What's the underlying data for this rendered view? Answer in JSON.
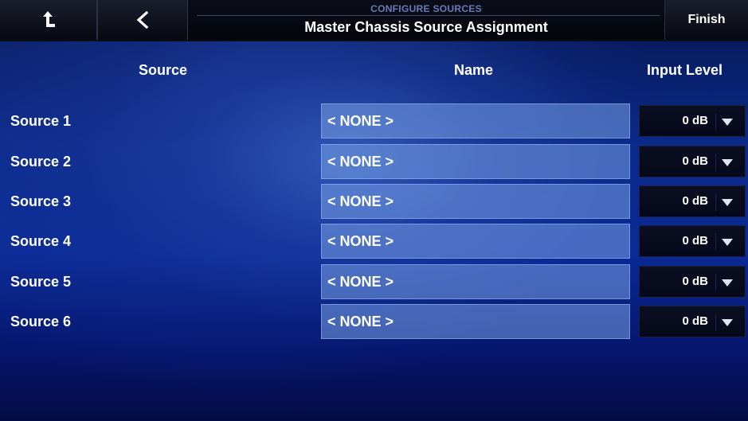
{
  "topbar": {
    "home_icon": "home-up-arrow-icon",
    "back_icon": "chevron-left-icon",
    "subtitle": "CONFIGURE SOURCES",
    "title": "Master Chassis Source Assignment",
    "finish_label": "Finish"
  },
  "headers": {
    "source": "Source",
    "name": "Name",
    "input_level": "Input Level"
  },
  "sources": [
    {
      "label": "Source 1",
      "name": "< NONE >",
      "level": "0 dB"
    },
    {
      "label": "Source 2",
      "name": "< NONE >",
      "level": "0 dB"
    },
    {
      "label": "Source 3",
      "name": "< NONE >",
      "level": "0 dB"
    },
    {
      "label": "Source 4",
      "name": "< NONE >",
      "level": "0 dB"
    },
    {
      "label": "Source 5",
      "name": "< NONE >",
      "level": "0 dB"
    },
    {
      "label": "Source 6",
      "name": "< NONE >",
      "level": "0 dB"
    }
  ],
  "colors": {
    "background": "#0b2a8a",
    "subtitle": "#6a7ab8",
    "name_field": "#7ea3e6",
    "level_select": "#0c0f22"
  },
  "icons": {
    "dropdown": "triangle-down-icon"
  }
}
